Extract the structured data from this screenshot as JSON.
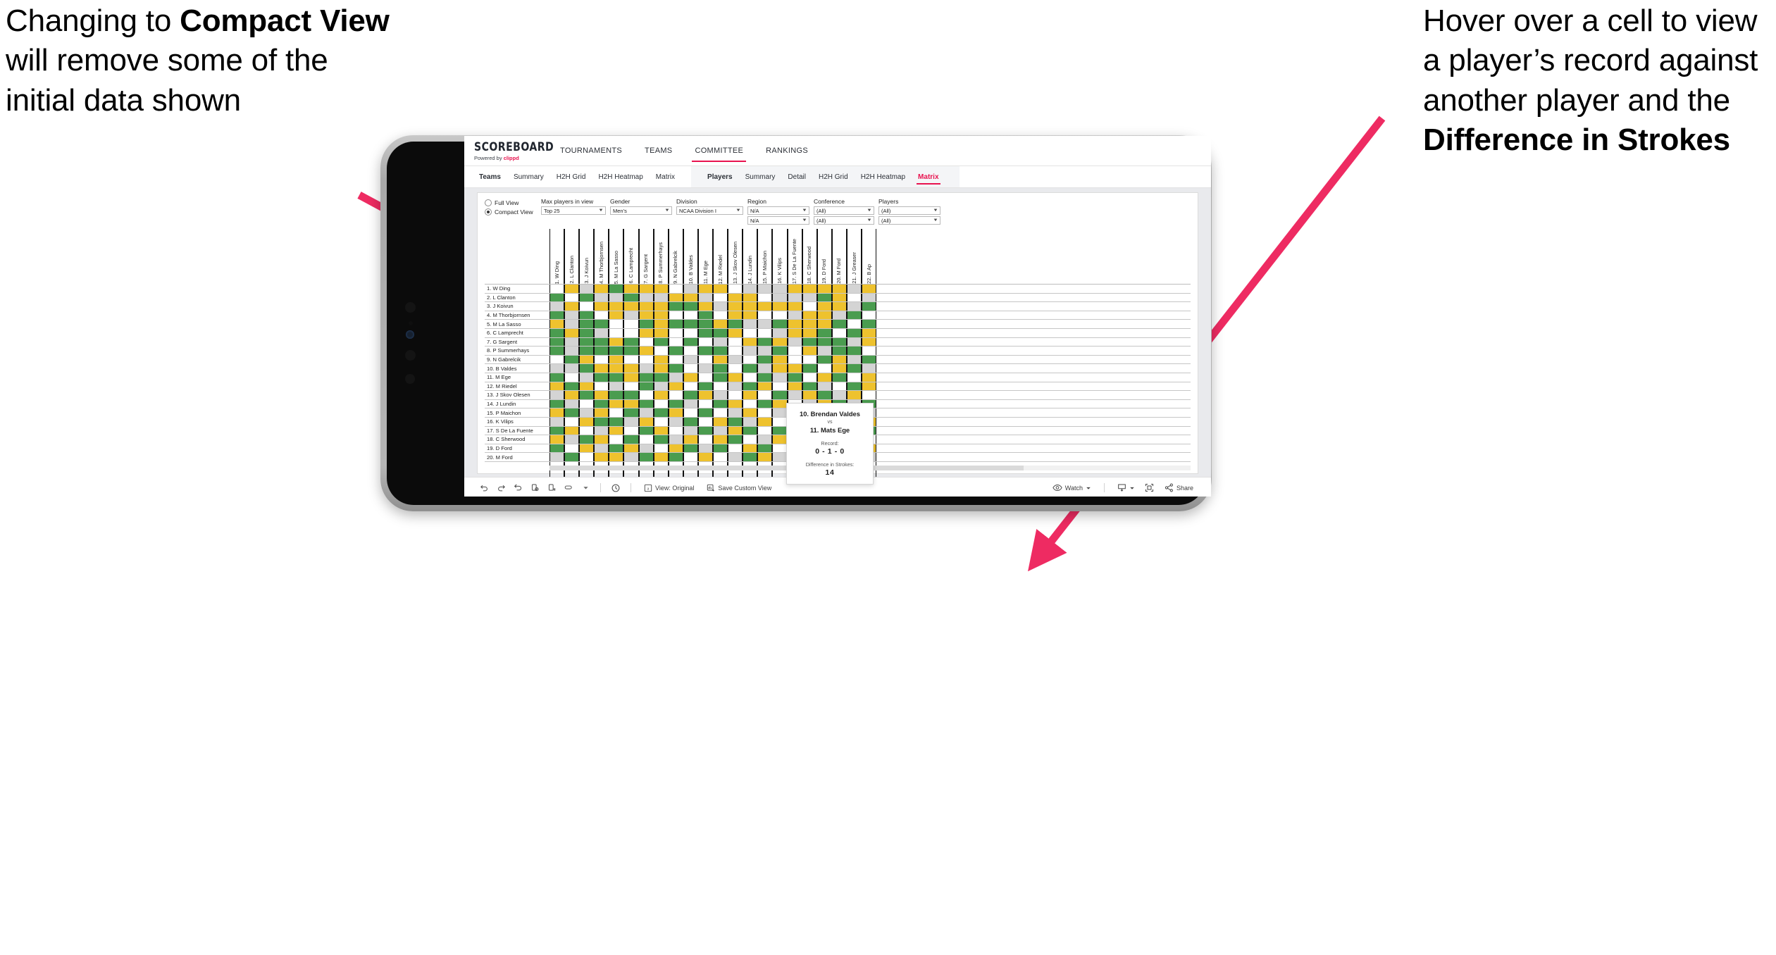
{
  "annotations": {
    "left": {
      "pre": "Changing to ",
      "bold": "Compact View",
      "post": " will remove some of the initial data shown"
    },
    "right": {
      "pre": "Hover over a cell to view a player’s record against another player and the ",
      "bold": "Difference in Strokes",
      "post": ""
    },
    "arrow_color": "#ee2b62"
  },
  "app": {
    "logo": {
      "main": "SCOREBOARD",
      "powered": "Powered by ",
      "brand": "clippd"
    },
    "nav_tabs": [
      {
        "label": "TOURNAMENTS",
        "active": false
      },
      {
        "label": "TEAMS",
        "active": false
      },
      {
        "label": "COMMITTEE",
        "active": true
      },
      {
        "label": "RANKINGS",
        "active": false
      }
    ],
    "sub_tabs_teams": [
      {
        "label": "Teams",
        "head": true,
        "active": false
      },
      {
        "label": "Summary",
        "head": false,
        "active": false
      },
      {
        "label": "H2H Grid",
        "head": false,
        "active": false
      },
      {
        "label": "H2H Heatmap",
        "head": false,
        "active": false
      },
      {
        "label": "Matrix",
        "head": false,
        "active": false
      }
    ],
    "sub_tabs_players": [
      {
        "label": "Players",
        "head": true,
        "active": false
      },
      {
        "label": "Summary",
        "head": false,
        "active": false
      },
      {
        "label": "Detail",
        "head": false,
        "active": false
      },
      {
        "label": "H2H Grid",
        "head": false,
        "active": false
      },
      {
        "label": "H2H Heatmap",
        "head": false,
        "active": false
      },
      {
        "label": "Matrix",
        "head": false,
        "active": true
      }
    ],
    "accent_color": "#e8134f"
  },
  "filters": {
    "view_mode": {
      "options": [
        {
          "label": "Full View",
          "selected": false
        },
        {
          "label": "Compact View",
          "selected": true
        }
      ]
    },
    "dropdowns": [
      {
        "label": "Max players in view",
        "value": "Top 25",
        "width": "w1"
      },
      {
        "label": "Gender",
        "value": "Men’s",
        "width": "w2"
      },
      {
        "label": "Division",
        "value": "NCAA Division I",
        "width": "w3"
      },
      {
        "label": "Region",
        "value": "N/A",
        "value2": "N/A",
        "width": "w4"
      },
      {
        "label": "Conference",
        "value": "(All)",
        "value2": "(All)",
        "width": "w5"
      },
      {
        "label": "Players",
        "value": "(All)",
        "value2": "(All)",
        "width": "w6"
      }
    ]
  },
  "matrix": {
    "columns": [
      "1. W Ding",
      "2. L Clanton",
      "3. J Koivun",
      "4. M Thorbjornsen",
      "5. M La Sasso",
      "6. C Lamprecht",
      "7. G Sargent",
      "8. P Summerhays",
      "9. N Gabrelcik",
      "10. B Valdes",
      "11. M Ege",
      "12. M Riedel",
      "13. J Skov Olesen",
      "14. J Lundin",
      "15. P Maichon",
      "16. K Vilips",
      "17. S De La Fuente",
      "18. C Sherwood",
      "19. D Ford",
      "20. M Ford",
      "21. J Greaser",
      "22. B Ap"
    ],
    "rows": [
      "1. W Ding",
      "2. L Clanton",
      "3. J Koivun",
      "4. M Thorbjornsen",
      "5. M La Sasso",
      "6. C Lamprecht",
      "7. G Sargent",
      "8. P Summerhays",
      "9. N Gabrelcik",
      "10. B Valdes",
      "11. M Ege",
      "12. M Riedel",
      "13. J Skov Olesen",
      "14. J Lundin",
      "15. P Maichon",
      "16. K Vilips",
      "17. S De La Fuente",
      "18. C Sherwood",
      "19. D Ford",
      "20. M Ford"
    ],
    "legend": {
      "win": "#4a9c4f",
      "loss": "#eec22e",
      "tie": "#d4d4d4",
      "none": "#ffffff"
    },
    "cells": [
      [
        "w",
        "y",
        "s",
        "y",
        "g",
        "y",
        "y",
        "y",
        "w",
        "s",
        "y",
        "y",
        "w",
        "s",
        "s",
        "s",
        "y",
        "y",
        "y",
        "y",
        "s",
        "y"
      ],
      [
        "g",
        "w",
        "g",
        "s",
        "s",
        "g",
        "s",
        "s",
        "y",
        "y",
        "s",
        "w",
        "y",
        "y",
        "w",
        "s",
        "s",
        "s",
        "g",
        "y",
        "w",
        "s"
      ],
      [
        "s",
        "y",
        "w",
        "y",
        "y",
        "y",
        "y",
        "y",
        "g",
        "g",
        "y",
        "s",
        "y",
        "y",
        "y",
        "y",
        "y",
        "w",
        "y",
        "y",
        "s",
        "g"
      ],
      [
        "g",
        "s",
        "g",
        "w",
        "y",
        "s",
        "y",
        "y",
        "w",
        "w",
        "g",
        "w",
        "y",
        "y",
        "w",
        "w",
        "s",
        "y",
        "y",
        "s",
        "g",
        "w"
      ],
      [
        "y",
        "s",
        "g",
        "g",
        "w",
        "w",
        "g",
        "y",
        "g",
        "g",
        "g",
        "y",
        "g",
        "s",
        "s",
        "g",
        "y",
        "y",
        "y",
        "g",
        "w",
        "g"
      ],
      [
        "g",
        "y",
        "g",
        "s",
        "w",
        "w",
        "y",
        "y",
        "w",
        "w",
        "g",
        "g",
        "y",
        "w",
        "w",
        "s",
        "y",
        "y",
        "g",
        "w",
        "g",
        "y"
      ],
      [
        "g",
        "s",
        "g",
        "g",
        "y",
        "g",
        "w",
        "g",
        "w",
        "g",
        "w",
        "s",
        "w",
        "y",
        "g",
        "y",
        "s",
        "g",
        "g",
        "g",
        "s",
        "y"
      ],
      [
        "g",
        "s",
        "g",
        "g",
        "g",
        "g",
        "y",
        "w",
        "g",
        "w",
        "g",
        "g",
        "w",
        "s",
        "s",
        "g",
        "w",
        "y",
        "s",
        "g",
        "g",
        "w"
      ],
      [
        "w",
        "g",
        "y",
        "w",
        "y",
        "w",
        "w",
        "y",
        "w",
        "s",
        "w",
        "y",
        "s",
        "w",
        "g",
        "y",
        "w",
        "w",
        "g",
        "y",
        "s",
        "g"
      ],
      [
        "s",
        "s",
        "g",
        "y",
        "y",
        "y",
        "s",
        "y",
        "g",
        "w",
        "s",
        "g",
        "w",
        "g",
        "s",
        "y",
        "y",
        "g",
        "w",
        "y",
        "g",
        "s"
      ],
      [
        "g",
        "w",
        "s",
        "g",
        "g",
        "y",
        "g",
        "g",
        "s",
        "y",
        "w",
        "g",
        "y",
        "w",
        "g",
        "s",
        "g",
        "w",
        "y",
        "g",
        "w",
        "y"
      ],
      [
        "y",
        "g",
        "y",
        "w",
        "s",
        "w",
        "g",
        "s",
        "y",
        "w",
        "g",
        "w",
        "s",
        "g",
        "y",
        "w",
        "y",
        "g",
        "s",
        "w",
        "g",
        "y"
      ],
      [
        "s",
        "y",
        "g",
        "y",
        "g",
        "g",
        "w",
        "y",
        "w",
        "g",
        "y",
        "s",
        "w",
        "y",
        "w",
        "g",
        "s",
        "y",
        "g",
        "s",
        "y",
        "w"
      ],
      [
        "g",
        "s",
        "w",
        "g",
        "y",
        "y",
        "g",
        "w",
        "g",
        "s",
        "w",
        "g",
        "y",
        "w",
        "g",
        "y",
        "w",
        "s",
        "y",
        "g",
        "s",
        "g"
      ],
      [
        "y",
        "g",
        "s",
        "y",
        "w",
        "g",
        "s",
        "g",
        "y",
        "w",
        "g",
        "w",
        "s",
        "y",
        "w",
        "s",
        "g",
        "y",
        "w",
        "y",
        "g",
        "s"
      ],
      [
        "s",
        "w",
        "y",
        "g",
        "g",
        "s",
        "y",
        "w",
        "s",
        "g",
        "w",
        "y",
        "g",
        "s",
        "y",
        "w",
        "g",
        "w",
        "s",
        "g",
        "y",
        "y"
      ],
      [
        "g",
        "y",
        "w",
        "s",
        "y",
        "w",
        "g",
        "y",
        "w",
        "s",
        "g",
        "s",
        "y",
        "g",
        "w",
        "g",
        "w",
        "y",
        "g",
        "s",
        "w",
        "g"
      ],
      [
        "y",
        "s",
        "g",
        "y",
        "w",
        "g",
        "w",
        "g",
        "s",
        "y",
        "w",
        "y",
        "g",
        "w",
        "s",
        "y",
        "g",
        "w",
        "y",
        "g",
        "s",
        "w"
      ],
      [
        "g",
        "w",
        "y",
        "s",
        "g",
        "y",
        "s",
        "w",
        "y",
        "g",
        "s",
        "g",
        "w",
        "y",
        "g",
        "w",
        "y",
        "s",
        "w",
        "g",
        "g",
        "y"
      ],
      [
        "s",
        "g",
        "w",
        "y",
        "y",
        "s",
        "g",
        "y",
        "g",
        "w",
        "y",
        "w",
        "s",
        "g",
        "y",
        "s",
        "g",
        "y",
        "g",
        "w",
        "y",
        "s"
      ]
    ]
  },
  "tooltip": {
    "player_a": "10. Brendan Valdes",
    "vs": "vs",
    "player_b": "11. Mats Ege",
    "record_label": "Record:",
    "record_value": "0 - 1 - 0",
    "strokes_label": "Difference in Strokes:",
    "strokes_value": "14"
  },
  "toolbar": {
    "icons": [
      {
        "name": "undo-icon"
      },
      {
        "name": "redo-icon"
      },
      {
        "name": "revert-icon"
      },
      {
        "name": "refresh-data-icon"
      },
      {
        "name": "pause-auto-update-icon"
      },
      {
        "name": "highlight-icon"
      },
      {
        "name": "highlight-dropdown-caret"
      }
    ],
    "clock_icon": "history-icon",
    "view_label": "View: Original",
    "save_label": "Save Custom View",
    "watch_label": "Watch",
    "download_icon": "download-icon",
    "fullscreen_icon": "fullscreen-icon",
    "share_label": "Share"
  }
}
